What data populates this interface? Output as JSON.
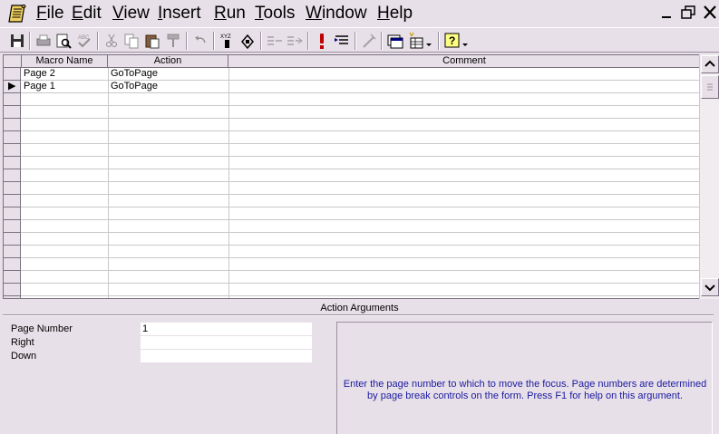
{
  "menu": {
    "items": [
      "File",
      "Edit",
      "View",
      "Insert",
      "Run",
      "Tools",
      "Window",
      "Help"
    ],
    "underline": [
      "F",
      "E",
      "V",
      "I",
      "R",
      "T",
      "W",
      "H"
    ],
    "rest": [
      "ile",
      "dit",
      "iew",
      "nsert",
      "un",
      "ools",
      "indow",
      "elp"
    ]
  },
  "window_controls": {
    "minimize": "_",
    "restore": "🗗",
    "close": "✕"
  },
  "toolbar": {
    "icons": [
      "save-icon",
      "print-icon",
      "print-preview-icon",
      "spelling-icon",
      "cut-icon",
      "copy-icon",
      "paste-icon",
      "format-painter-icon",
      "undo-icon",
      "macro-names-icon",
      "conditions-icon",
      "insert-rows-icon",
      "delete-rows-icon",
      "run-icon",
      "single-step-icon",
      "build-icon",
      "database-window-icon",
      "new-object-icon",
      "help-icon"
    ]
  },
  "grid": {
    "columns": [
      "Macro Name",
      "Action",
      "Comment"
    ],
    "rows": [
      {
        "macro_name": "Page 2",
        "action": "GoToPage",
        "comment": ""
      },
      {
        "macro_name": "Page 1",
        "action": "GoToPage",
        "comment": ""
      }
    ],
    "current_row_marker": "▶"
  },
  "action_arguments": {
    "title": "Action Arguments",
    "fields": [
      {
        "label": "Page Number",
        "value": "1"
      },
      {
        "label": "Right",
        "value": ""
      },
      {
        "label": "Down",
        "value": ""
      }
    ],
    "help": "Enter the page number to which to move the focus. Page numbers are determined by page break controls on the form. Press F1 for help on this argument."
  },
  "colors": {
    "chrome": "#e8e0e8",
    "help_text": "#1a1aa0",
    "run_icon": "#c00000"
  }
}
